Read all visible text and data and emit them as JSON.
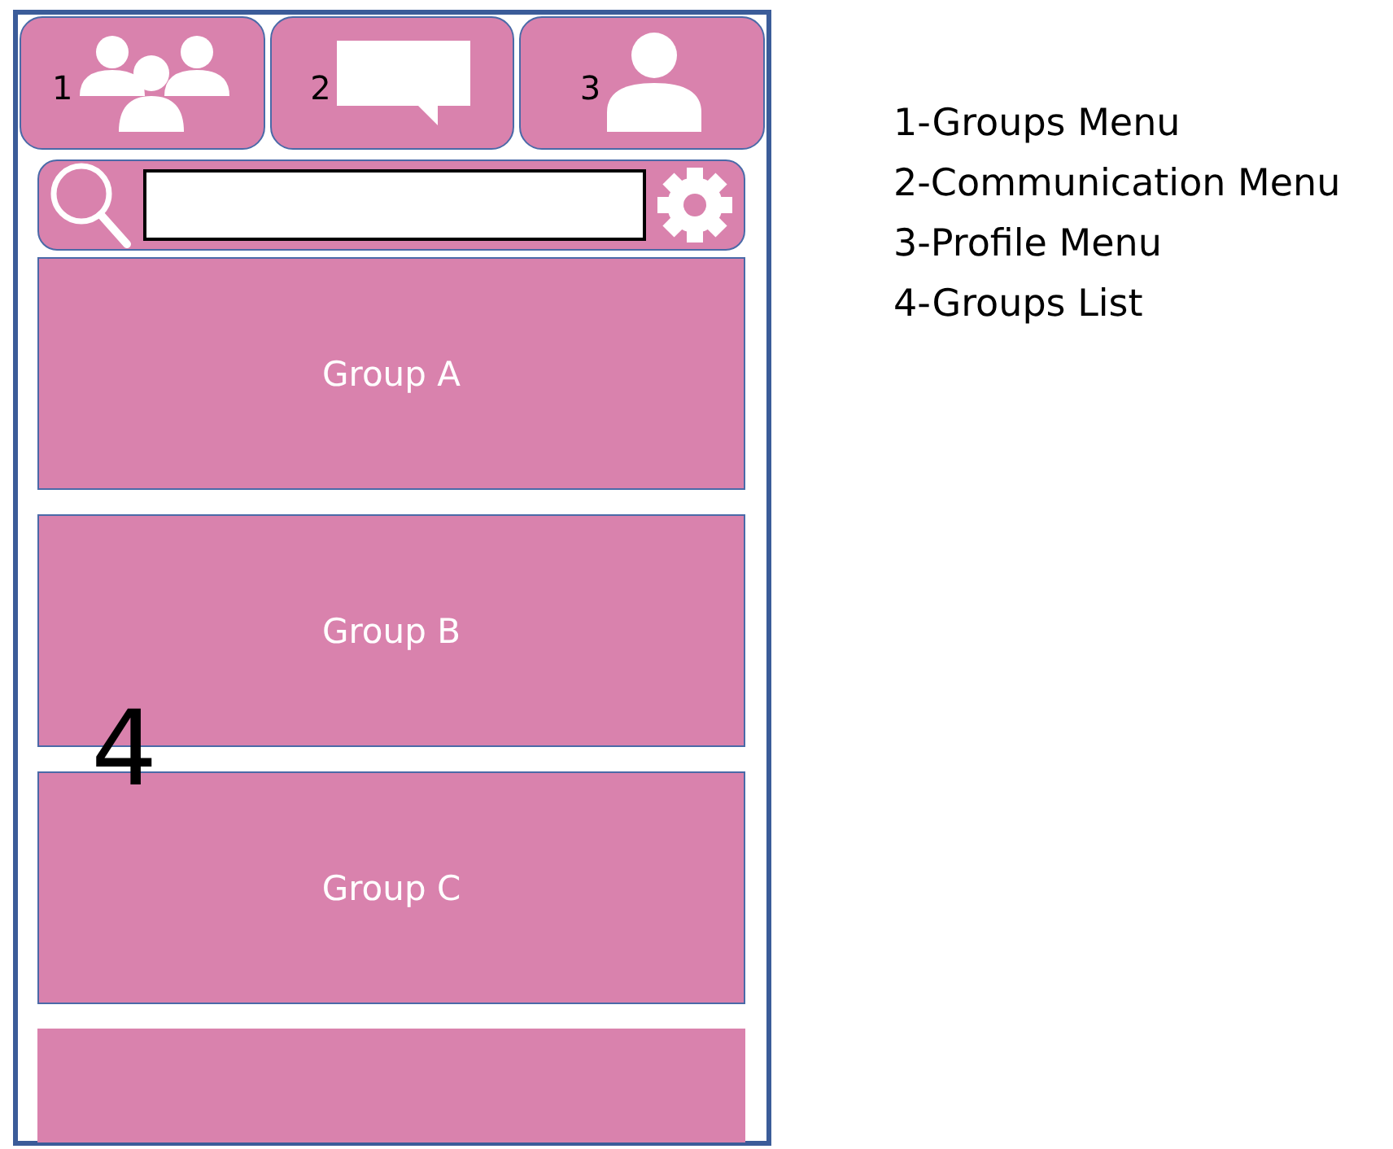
{
  "tabs": [
    {
      "number": "1",
      "kind": "groups"
    },
    {
      "number": "2",
      "kind": "chat"
    },
    {
      "number": "3",
      "kind": "profile"
    }
  ],
  "groups_list": {
    "marker": "4",
    "items": [
      {
        "label": "Group A"
      },
      {
        "label": "Group B"
      },
      {
        "label": "Group C"
      }
    ]
  },
  "legend": [
    "1-Groups Menu",
    "2-Communication Menu",
    "3-Profile Menu",
    "4-Groups List"
  ]
}
